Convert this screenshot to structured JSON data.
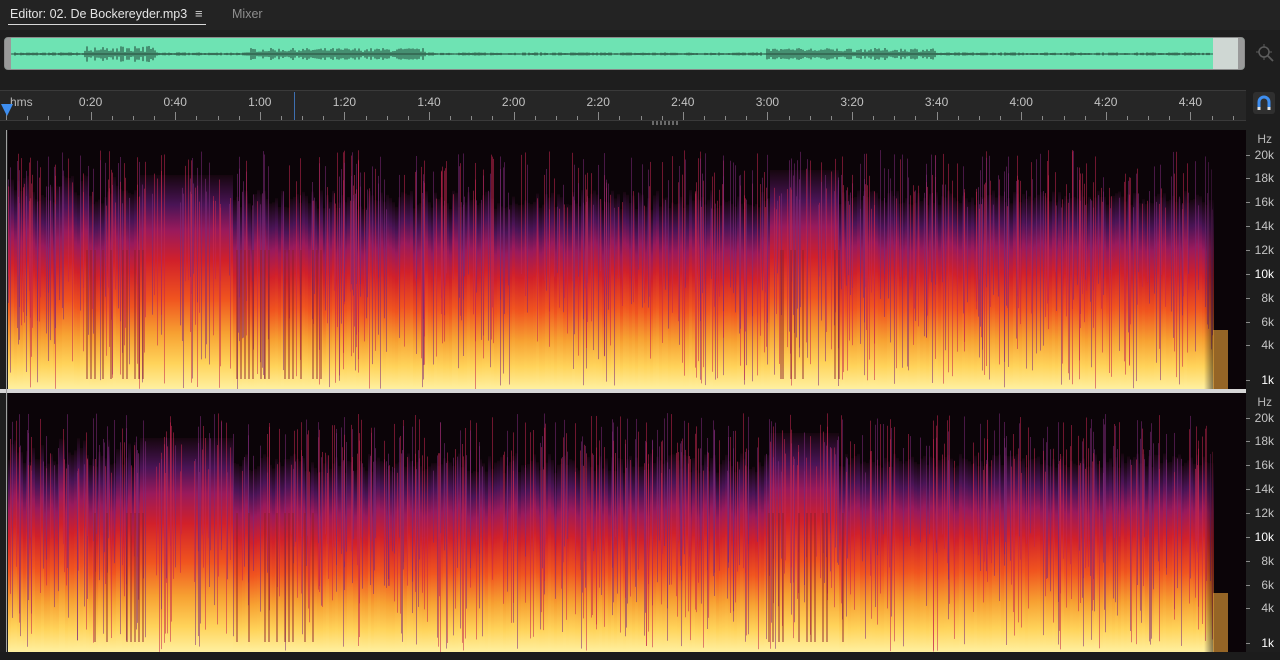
{
  "tabs": {
    "editor_label": "Editor: 02. De Bockereyder.mp3",
    "menu_glyph": "≡",
    "mixer_label": "Mixer"
  },
  "overview": {
    "waveform_color": "#6ee3b3",
    "icon": "zoom-to-selection-icon"
  },
  "ruler": {
    "units_label": "hms",
    "ticks": [
      "0:20",
      "0:40",
      "1:00",
      "1:20",
      "1:40",
      "2:00",
      "2:20",
      "2:40",
      "3:00",
      "3:20",
      "3:40",
      "4:00",
      "4:20",
      "4:40"
    ],
    "playhead_color": "#3e8ef0",
    "snap_icon": "magnet-icon"
  },
  "channels": [
    {
      "name": "left",
      "hz_unit": "Hz",
      "hz_labels": [
        "20k",
        "18k",
        "16k",
        "14k",
        "12k",
        "10k",
        "8k",
        "6k",
        "4k",
        "1k"
      ]
    },
    {
      "name": "right",
      "hz_unit": "Hz",
      "hz_labels": [
        "20k",
        "18k",
        "16k",
        "14k",
        "12k",
        "10k",
        "8k",
        "6k",
        "4k",
        "1k"
      ]
    }
  ],
  "spectrogram_colors": {
    "low": "#ffe27a",
    "mid": "#f23a1c",
    "high": "#7a1f74",
    "silent": "#0b0408"
  }
}
